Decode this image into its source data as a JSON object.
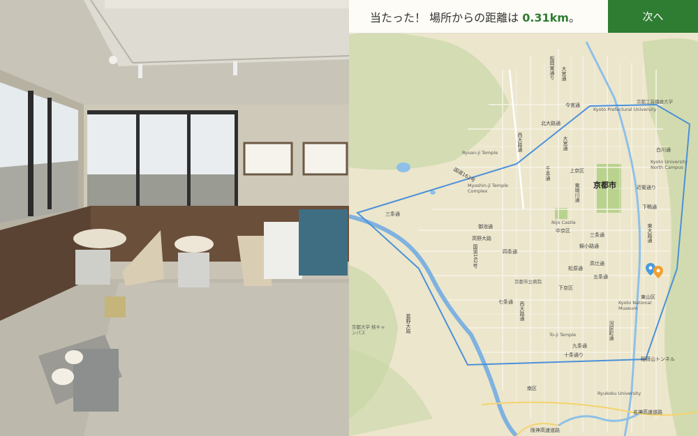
{
  "result": {
    "prefix": "当たった！ 場所からの距離は ",
    "distance": "0.31km",
    "suffix": "。"
  },
  "next_button": {
    "label": "次へ"
  },
  "colors": {
    "accent": "#2e7d32",
    "boundary": "#4a90d9",
    "guess_pin": "#4a9bd9",
    "answer_pin": "#f0a030"
  },
  "map": {
    "city_label": "京都市",
    "labels": [
      {
        "text": "船岡東通り",
        "kind": "vert"
      },
      {
        "text": "大宮通",
        "kind": "vert"
      },
      {
        "text": "今宮通",
        "kind": "plain"
      },
      {
        "text": "京都工芸繊維大学",
        "kind": "poi"
      },
      {
        "text": "Kyoto Prefectural University",
        "kind": "poi"
      },
      {
        "text": "北大路通",
        "kind": "plain"
      },
      {
        "text": "西大路通",
        "kind": "vert"
      },
      {
        "text": "大宮通",
        "kind": "vert"
      },
      {
        "text": "Ryoan-ji Temple",
        "kind": "poi"
      },
      {
        "text": "白川通",
        "kind": "plain"
      },
      {
        "text": "Kyoto University North Campus",
        "kind": "poi"
      },
      {
        "text": "国道162号",
        "kind": "plain"
      },
      {
        "text": "千本通",
        "kind": "vert"
      },
      {
        "text": "上京区",
        "kind": "plain"
      },
      {
        "text": "Myoshin-ji Temple Complex",
        "kind": "poi"
      },
      {
        "text": "近衛通り",
        "kind": "plain"
      },
      {
        "text": "東堀川通",
        "kind": "vert"
      },
      {
        "text": "下鴨通",
        "kind": "plain"
      },
      {
        "text": "三条通",
        "kind": "plain"
      },
      {
        "text": "Nijo Castle",
        "kind": "poi"
      },
      {
        "text": "御池通",
        "kind": "plain"
      },
      {
        "text": "三条通",
        "kind": "plain"
      },
      {
        "text": "中京区",
        "kind": "plain"
      },
      {
        "text": "高野大路",
        "kind": "plain"
      },
      {
        "text": "国道162号",
        "kind": "vert"
      },
      {
        "text": "四条通",
        "kind": "plain"
      },
      {
        "text": "錦小路通",
        "kind": "plain"
      },
      {
        "text": "松原通",
        "kind": "plain"
      },
      {
        "text": "高辻通",
        "kind": "plain"
      },
      {
        "text": "五条通",
        "kind": "plain"
      },
      {
        "text": "京都市立病院",
        "kind": "poi"
      },
      {
        "text": "下京区",
        "kind": "plain"
      },
      {
        "text": "七条通",
        "kind": "plain"
      },
      {
        "text": "東山区",
        "kind": "plain"
      },
      {
        "text": "Kyoto National Museum",
        "kind": "poi"
      },
      {
        "text": "京都大学 桂キャンパス",
        "kind": "poi"
      },
      {
        "text": "To-ji Temple",
        "kind": "poi"
      },
      {
        "text": "九条通",
        "kind": "plain"
      },
      {
        "text": "十条通り",
        "kind": "plain"
      },
      {
        "text": "稲荷山トンネル",
        "kind": "plain"
      },
      {
        "text": "南区",
        "kind": "plain"
      },
      {
        "text": "Ryukoku University",
        "kind": "poi"
      },
      {
        "text": "名神高速道路",
        "kind": "plain"
      },
      {
        "text": "阪神高速道路",
        "kind": "plain"
      },
      {
        "text": "東大路通",
        "kind": "vert"
      },
      {
        "text": "河原町通",
        "kind": "vert"
      },
      {
        "text": "西大路通",
        "kind": "vert"
      },
      {
        "text": "葛野大路",
        "kind": "vert"
      }
    ]
  }
}
